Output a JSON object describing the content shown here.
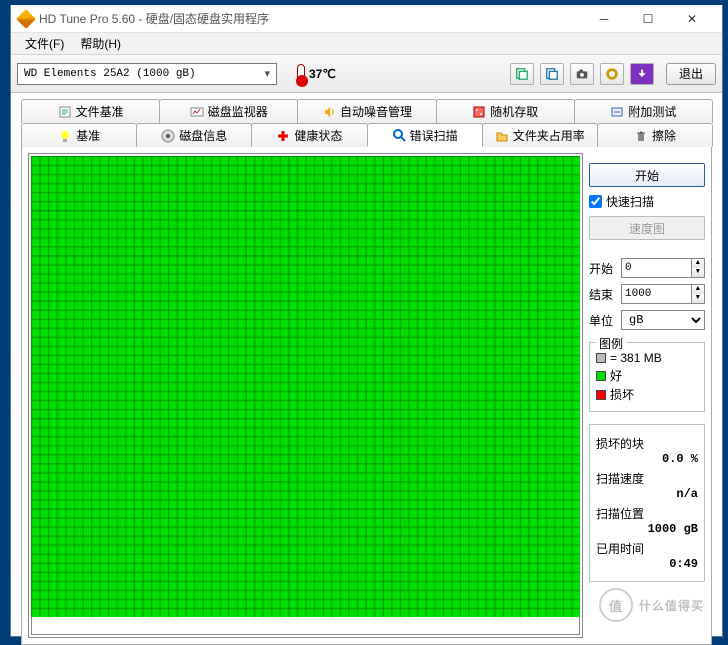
{
  "window": {
    "title": "HD Tune Pro 5.60 - 硬盘/固态硬盘实用程序"
  },
  "menu": {
    "file": "文件(F)",
    "help": "帮助(H)"
  },
  "toolbar": {
    "drive": "WD    Elements 25A2 (1000 gB)",
    "temperature": "37℃",
    "exit": "退出"
  },
  "tabs_row1": [
    {
      "label": "文件基准",
      "icon": "file-bench-icon"
    },
    {
      "label": "磁盘监视器",
      "icon": "monitor-icon"
    },
    {
      "label": "自动噪音管理",
      "icon": "speaker-icon"
    },
    {
      "label": "随机存取",
      "icon": "random-icon"
    },
    {
      "label": "附加测试",
      "icon": "extra-icon"
    }
  ],
  "tabs_row2": [
    {
      "label": "基准",
      "icon": "bulb-icon"
    },
    {
      "label": "磁盘信息",
      "icon": "info-icon"
    },
    {
      "label": "健康状态",
      "icon": "health-icon"
    },
    {
      "label": "错误扫描",
      "icon": "search-icon"
    },
    {
      "label": "文件夹占用率",
      "icon": "folder-icon"
    },
    {
      "label": "擦除",
      "icon": "trash-icon"
    }
  ],
  "active_tab": "错误扫描",
  "panel": {
    "start_btn": "开始",
    "quick_scan": "快速扫描",
    "speed_map_btn": "速度图",
    "start_label": "开始",
    "start_value": "0",
    "end_label": "结束",
    "end_value": "1000",
    "unit_label": "单位",
    "unit_value": "gB",
    "legend": {
      "title": "图例",
      "block_size": "= 381 MB",
      "good": "好",
      "bad": "损坏"
    },
    "stats": {
      "damaged_blocks_label": "损坏的块",
      "damaged_blocks_value": "0.0 %",
      "scan_speed_label": "扫描速度",
      "scan_speed_value": "n/a",
      "scan_pos_label": "扫描位置",
      "scan_pos_value": "1000 gB",
      "elapsed_label": "已用时间",
      "elapsed_value": "0:49"
    }
  },
  "chart_data": {
    "type": "heatmap",
    "cols": 64,
    "rows": 51,
    "cell": "good",
    "colors": {
      "good": "#00e000",
      "bad": "#ff0000",
      "grid": "#009000"
    }
  },
  "watermark": "什么值得买"
}
